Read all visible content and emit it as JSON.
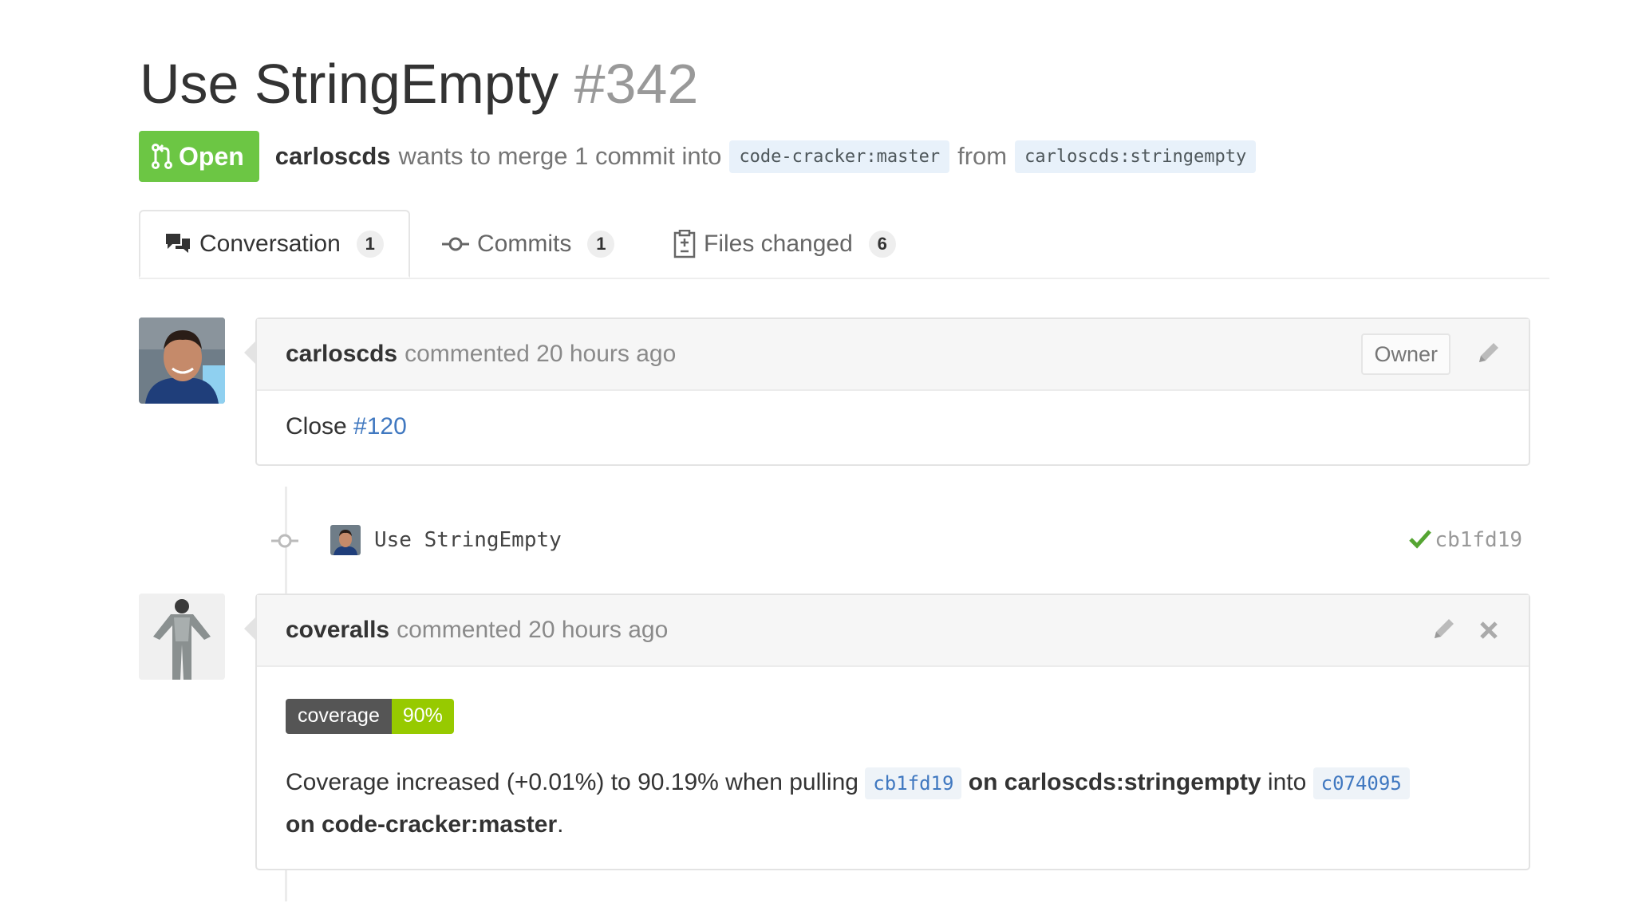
{
  "pr": {
    "title": "Use StringEmpty",
    "number": "#342",
    "state": "Open",
    "author": "carloscds",
    "merge_text": "wants to merge 1 commit into",
    "base_branch": "code-cracker:master",
    "from_text": "from",
    "head_branch": "carloscds:stringempty"
  },
  "tabs": [
    {
      "label": "Conversation",
      "count": "1"
    },
    {
      "label": "Commits",
      "count": "1"
    },
    {
      "label": "Files changed",
      "count": "6"
    }
  ],
  "comments": [
    {
      "author": "carloscds",
      "meta": "commented 20 hours ago",
      "badge": "Owner",
      "body_prefix": "Close",
      "body_link": "#120"
    },
    {
      "author": "coveralls",
      "meta": "commented 20 hours ago",
      "coverage_label": "coverage",
      "coverage_value": "90%",
      "text_1": "Coverage increased (+0.01%) to 90.19% when pulling",
      "sha_1": "cb1fd19",
      "text_2": "on carloscds:stringempty",
      "text_3": "into",
      "sha_2": "c074095",
      "text_4": "on code-cracker:master",
      "text_5": "."
    }
  ],
  "commit": {
    "message": "Use StringEmpty",
    "sha": "cb1fd19",
    "status": "success"
  },
  "colors": {
    "open_green": "#6cc644",
    "link_blue": "#4078c0",
    "coverage_green": "#97ca00",
    "check_green": "#55a532"
  },
  "icons": [
    "git-pull-request-icon",
    "comment-discussion-icon",
    "git-commit-icon",
    "diff-icon",
    "pencil-icon",
    "close-icon",
    "check-icon"
  ]
}
